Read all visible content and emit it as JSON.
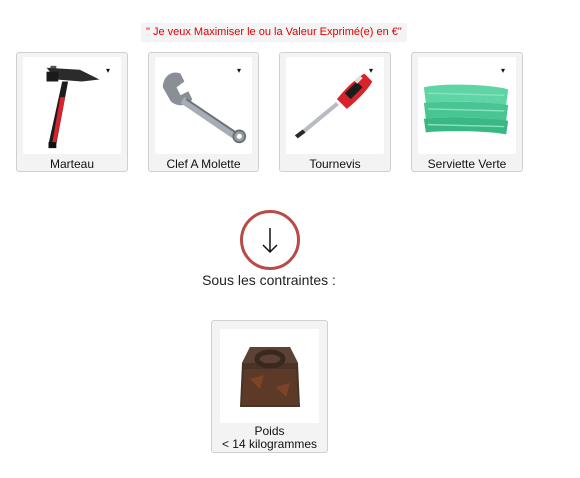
{
  "objective": "\" Je veux Maximiser le ou la Valeur Exprimé(e) en €\"",
  "items": [
    {
      "label": "Marteau",
      "icon": "hammer-icon"
    },
    {
      "label": "Clef A Molette",
      "icon": "wrench-icon"
    },
    {
      "label": "Tournevis",
      "icon": "screwdriver-icon"
    },
    {
      "label": "Serviette Verte",
      "icon": "towel-icon"
    }
  ],
  "dropdown_caret": "▾",
  "arrow_icon": "arrow-down-icon",
  "constraints_label": "Sous les contraintes :",
  "constraint": {
    "label": "Poids",
    "condition": "< 14 kilogrammes",
    "icon": "weight-icon"
  },
  "colors": {
    "objective_text": "#e00000",
    "arrow_circle": "#b94a48",
    "card_bg": "#f3f3f3",
    "card_border": "#cfcfcf"
  }
}
